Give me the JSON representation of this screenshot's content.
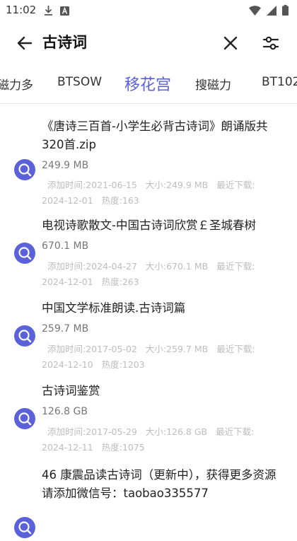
{
  "status_bar": {
    "time": "11:02",
    "icons": [
      "download-icon",
      "app-a-icon",
      "wifi-icon",
      "signal-icon",
      "battery-icon"
    ]
  },
  "search": {
    "query": "古诗词",
    "icons": [
      "back-arrow-icon",
      "close-icon",
      "filter-sliders-icon"
    ]
  },
  "tabs": [
    {
      "label": "磁力多",
      "active": false
    },
    {
      "label": "BTSOW",
      "active": false
    },
    {
      "label": "移花宫",
      "active": true
    },
    {
      "label": "搜磁力",
      "active": false
    },
    {
      "label": "BT102",
      "active": false
    }
  ],
  "colors": {
    "accent": "#5a5fdc",
    "meta_text": "#bdbdbd"
  },
  "results": [
    {
      "title": "《唐诗三百首-小学生必背古诗词》朗诵版共320首.zip",
      "size": "249.9 MB",
      "added": "添加时间:2021-06-15",
      "size_meta": "大小:249.9 MB",
      "recent": "最近下载:",
      "recent_date": "2024-12-01",
      "heat": "热度:163"
    },
    {
      "title": "电视诗歌散文-中国古诗词欣赏￡圣城春树",
      "size": "670.1 MB",
      "added": "添加时间:2024-04-27",
      "size_meta": "大小:670.1 MB",
      "recent": "最近下载:",
      "recent_date": "2024-12-01",
      "heat": "热度:263"
    },
    {
      "title": "中国文学标准朗读.古诗词篇",
      "size": "259.7 MB",
      "added": "添加时间:2017-05-02",
      "size_meta": "大小:259.7 MB",
      "recent": "最近下载:",
      "recent_date": "2024-12-10",
      "heat": "热度:1203"
    },
    {
      "title": "古诗词鉴赏",
      "size": "126.8 GB",
      "added": "添加时间:2017-05-29",
      "size_meta": "大小:126.8 GB",
      "recent": "最近下载:",
      "recent_date": "2024-12-11",
      "heat": "热度:1075"
    },
    {
      "title": "46 康震品读古诗词（更新中），获得更多资源请添加微信号：taobao335577",
      "size": "",
      "added": "",
      "size_meta": "",
      "recent": "",
      "recent_date": "",
      "heat": ""
    }
  ]
}
